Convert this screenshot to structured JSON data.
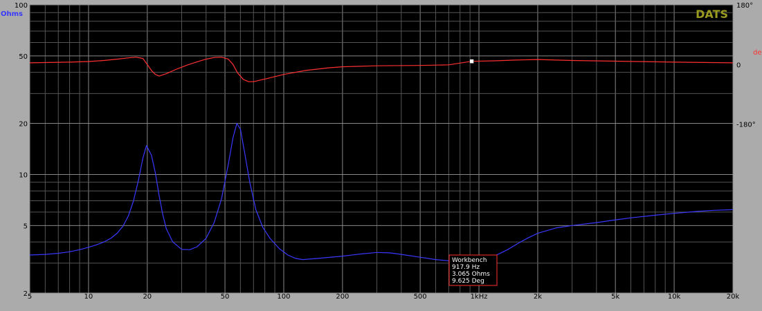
{
  "app": {
    "brand": "DATS"
  },
  "colors": {
    "background": "#000000",
    "frame": "#ababab",
    "grid": "#555555",
    "grid_major": "#888888",
    "impedance": "#3838ff",
    "phase": "#ff3030",
    "brand": "#9a9a20",
    "cursor_box": "#ff3030"
  },
  "chart_data": {
    "type": "line",
    "x_scale": "log",
    "xlim": [
      5,
      20000
    ],
    "x_ticks": [
      {
        "v": 5,
        "label": "5"
      },
      {
        "v": 10,
        "label": "10"
      },
      {
        "v": 20,
        "label": "20"
      },
      {
        "v": 50,
        "label": "50"
      },
      {
        "v": 100,
        "label": "100"
      },
      {
        "v": 200,
        "label": "200"
      },
      {
        "v": 500,
        "label": "500"
      },
      {
        "v": 1000,
        "label": "1kHz"
      },
      {
        "v": 2000,
        "label": "2k"
      },
      {
        "v": 5000,
        "label": "5k"
      },
      {
        "v": 10000,
        "label": "10k"
      },
      {
        "v": 20000,
        "label": "20k"
      }
    ],
    "y_left": {
      "unit_label": "Ohms",
      "scale": "log",
      "ylim": [
        2,
        100
      ],
      "ticks": [
        {
          "v": 100,
          "label": "100"
        },
        {
          "v": 50,
          "label": "50"
        },
        {
          "v": 20,
          "label": "20"
        },
        {
          "v": 10,
          "label": "10"
        },
        {
          "v": 5,
          "label": "5"
        },
        {
          "v": 2,
          "label": "2"
        }
      ]
    },
    "y_right": {
      "unit_label": "deg",
      "scale": "linear",
      "ylim": [
        -690,
        180
      ],
      "ticks": [
        {
          "v": 180,
          "label": "180°"
        },
        {
          "v": 0,
          "label": "0"
        },
        {
          "v": -180,
          "label": "-180°"
        }
      ]
    },
    "grid": true,
    "series": [
      {
        "key": "impedance",
        "axis": "left",
        "color": "#3838ff",
        "points": [
          [
            5,
            3.35
          ],
          [
            6,
            3.38
          ],
          [
            7,
            3.43
          ],
          [
            8,
            3.5
          ],
          [
            9,
            3.6
          ],
          [
            10,
            3.72
          ],
          [
            11,
            3.85
          ],
          [
            12,
            4.0
          ],
          [
            13,
            4.2
          ],
          [
            14,
            4.5
          ],
          [
            15,
            4.95
          ],
          [
            16,
            5.7
          ],
          [
            17,
            7.0
          ],
          [
            18,
            9.2
          ],
          [
            19,
            12.5
          ],
          [
            19.8,
            14.8
          ],
          [
            21,
            13.0
          ],
          [
            22,
            10.2
          ],
          [
            23,
            7.5
          ],
          [
            24,
            5.8
          ],
          [
            25,
            4.8
          ],
          [
            27,
            4.0
          ],
          [
            30,
            3.62
          ],
          [
            33,
            3.6
          ],
          [
            36,
            3.75
          ],
          [
            40,
            4.2
          ],
          [
            44,
            5.2
          ],
          [
            48,
            7.2
          ],
          [
            52,
            11.5
          ],
          [
            55,
            16.5
          ],
          [
            57.5,
            20.0
          ],
          [
            60,
            18.5
          ],
          [
            63,
            13.5
          ],
          [
            67,
            9.0
          ],
          [
            72,
            6.2
          ],
          [
            78,
            4.9
          ],
          [
            85,
            4.2
          ],
          [
            95,
            3.65
          ],
          [
            105,
            3.35
          ],
          [
            115,
            3.2
          ],
          [
            125,
            3.15
          ],
          [
            150,
            3.2
          ],
          [
            200,
            3.3
          ],
          [
            250,
            3.4
          ],
          [
            300,
            3.47
          ],
          [
            350,
            3.45
          ],
          [
            400,
            3.38
          ],
          [
            500,
            3.25
          ],
          [
            600,
            3.15
          ],
          [
            700,
            3.1
          ],
          [
            800,
            3.07
          ],
          [
            917.9,
            3.065
          ],
          [
            1000,
            3.1
          ],
          [
            1200,
            3.3
          ],
          [
            1400,
            3.6
          ],
          [
            1600,
            3.95
          ],
          [
            1800,
            4.25
          ],
          [
            2000,
            4.5
          ],
          [
            2500,
            4.85
          ],
          [
            3000,
            5.0
          ],
          [
            4000,
            5.2
          ],
          [
            5000,
            5.4
          ],
          [
            6000,
            5.55
          ],
          [
            8000,
            5.75
          ],
          [
            10000,
            5.9
          ],
          [
            13000,
            6.05
          ],
          [
            16000,
            6.15
          ],
          [
            20000,
            6.2
          ]
        ]
      },
      {
        "key": "phase",
        "axis": "right",
        "color": "#ff3030",
        "points": [
          [
            5,
            5
          ],
          [
            8,
            7
          ],
          [
            10,
            9
          ],
          [
            12,
            12
          ],
          [
            14,
            16
          ],
          [
            16,
            20
          ],
          [
            17.5,
            22
          ],
          [
            19,
            18
          ],
          [
            20,
            0
          ],
          [
            21,
            -18
          ],
          [
            22,
            -30
          ],
          [
            23,
            -35
          ],
          [
            25,
            -28
          ],
          [
            28,
            -15
          ],
          [
            32,
            -2
          ],
          [
            36,
            8
          ],
          [
            40,
            16
          ],
          [
            44,
            21
          ],
          [
            48,
            22
          ],
          [
            52,
            16
          ],
          [
            55,
            0
          ],
          [
            58,
            -25
          ],
          [
            62,
            -45
          ],
          [
            66,
            -52
          ],
          [
            70,
            -52
          ],
          [
            80,
            -44
          ],
          [
            100,
            -30
          ],
          [
            130,
            -18
          ],
          [
            170,
            -10
          ],
          [
            200,
            -7
          ],
          [
            300,
            -4
          ],
          [
            500,
            -3
          ],
          [
            700,
            -1
          ],
          [
            917.9,
            9.625
          ],
          [
            1200,
            11
          ],
          [
            1500,
            13
          ],
          [
            2000,
            15
          ],
          [
            3000,
            12
          ],
          [
            5000,
            10
          ],
          [
            10000,
            7
          ],
          [
            20000,
            5
          ]
        ]
      }
    ],
    "cursor": {
      "freq": 917.9,
      "phase_deg": 9.625,
      "lines": [
        "Workbench",
        "917.9 Hz",
        "3.065 Ohms",
        "9.625 Deg"
      ]
    }
  }
}
